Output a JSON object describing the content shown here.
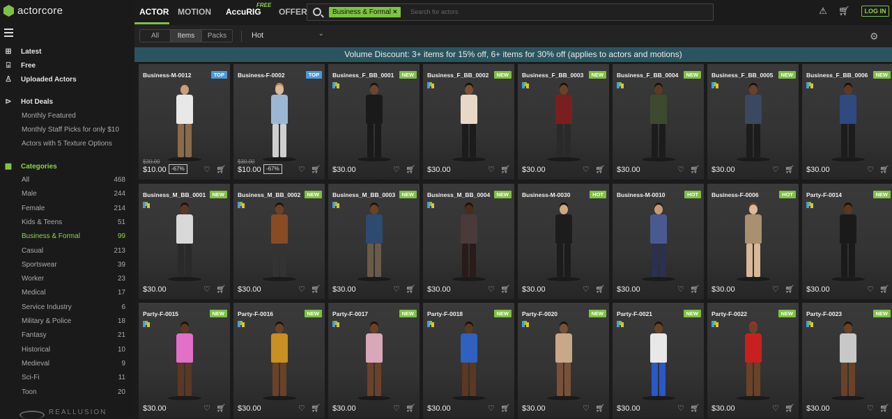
{
  "brand": {
    "logo_text": "actorcore",
    "footer_text": "REALLUSION"
  },
  "sidebar": {
    "main": [
      {
        "label": "Latest",
        "icon": "new-icon"
      },
      {
        "label": "Free",
        "icon": "gift-icon"
      },
      {
        "label": "Uploaded Actors",
        "icon": "user-upload-icon"
      }
    ],
    "hot_deals": {
      "label": "Hot Deals",
      "icon": "tag-icon",
      "items": [
        "Monthly Featured",
        "Monthly Staff Picks for only $10",
        "Actors with 5 Texture Options"
      ]
    },
    "categories": {
      "label": "Categories",
      "icon": "grid-icon",
      "items": [
        {
          "label": "All",
          "count": "468"
        },
        {
          "label": "Male",
          "count": "244"
        },
        {
          "label": "Female",
          "count": "214"
        },
        {
          "label": "Kids & Teens",
          "count": "51"
        },
        {
          "label": "Business & Formal",
          "count": "99",
          "active": true
        },
        {
          "label": "Casual",
          "count": "213"
        },
        {
          "label": "Sportswear",
          "count": "39"
        },
        {
          "label": "Worker",
          "count": "23"
        },
        {
          "label": "Medical",
          "count": "17"
        },
        {
          "label": "Service Industry",
          "count": "6"
        },
        {
          "label": "Military & Police",
          "count": "18"
        },
        {
          "label": "Fantasy",
          "count": "21"
        },
        {
          "label": "Historical",
          "count": "10"
        },
        {
          "label": "Medieval",
          "count": "9"
        },
        {
          "label": "Sci-Fi",
          "count": "11"
        },
        {
          "label": "Toon",
          "count": "20"
        }
      ]
    }
  },
  "topnav": {
    "tabs": [
      "ACTOR",
      "MOTION",
      "AccuRIG",
      "OFFER"
    ],
    "accurig_badge": "FREE",
    "search_chip": "Business & Formal",
    "search_chip_close": "×",
    "search_placeholder": "Search for actors",
    "login": "LOG IN"
  },
  "filter": {
    "segments": [
      "All",
      "Items",
      "Packs"
    ],
    "active_segment": "Items",
    "sort": "Hot"
  },
  "banner": "Volume Discount: 3+ items for 15% off, 6+ items for 30% off (applies to actors and motions)",
  "cards": [
    {
      "name": "Business-M-0012",
      "badge": "TOP",
      "price": "$10.00",
      "old_price": "$30.00",
      "discount": "-67%",
      "icon": false,
      "skin": "#c9a07c",
      "top": "#e8e8e8",
      "legs": "#8a6a48",
      "hair": "#4a3526"
    },
    {
      "name": "Business-F-0002",
      "badge": "TOP",
      "price": "$10.00",
      "old_price": "$30.00",
      "discount": "-67%",
      "icon": false,
      "skin": "#e0b898",
      "top": "#9cb7d4",
      "legs": "#cfcfcf",
      "hair": "#b08858"
    },
    {
      "name": "Business_F_BB_0001",
      "badge": "NEW",
      "price": "$30.00",
      "icon": true,
      "skin": "#6b4630",
      "top": "#1a1a1a",
      "legs": "#1a1a1a",
      "hair": "#1a1208"
    },
    {
      "name": "Business_F_BB_0002",
      "badge": "NEW",
      "price": "$30.00",
      "icon": true,
      "skin": "#7a5038",
      "top": "#e8d8c8",
      "legs": "#1c1c1c",
      "hair": "#1a1208"
    },
    {
      "name": "Business_F_BB_0003",
      "badge": "NEW",
      "price": "$30.00",
      "icon": true,
      "skin": "#6a4228",
      "top": "#7a1f1f",
      "legs": "#2a2a2a",
      "hair": "#1a1208"
    },
    {
      "name": "Business_F_BB_0004",
      "badge": "NEW",
      "price": "$30.00",
      "icon": true,
      "skin": "#5e3a24",
      "top": "#3e4a30",
      "legs": "#1c1c1c",
      "hair": "#1a1208"
    },
    {
      "name": "Business_F_BB_0005",
      "badge": "NEW",
      "price": "$30.00",
      "icon": true,
      "skin": "#6a4228",
      "top": "#3a4860",
      "legs": "#1c1c1c",
      "hair": "#1a1208"
    },
    {
      "name": "Business_F_BB_0006",
      "badge": "NEW",
      "price": "$30.00",
      "icon": true,
      "skin": "#5e3a24",
      "top": "#2e4a80",
      "legs": "#1c1c1c",
      "hair": "#1a1208"
    },
    {
      "name": "Business_M_BB_0001",
      "badge": "NEW",
      "price": "$30.00",
      "icon": true,
      "skin": "#5a3822",
      "top": "#d8d8d8",
      "legs": "#2a2a2a",
      "hair": "#1a1208"
    },
    {
      "name": "Business_M_BB_0002",
      "badge": "NEW",
      "price": "$30.00",
      "icon": true,
      "skin": "#6a4228",
      "top": "#8a4a22",
      "legs": "#333333",
      "hair": "#1a1208"
    },
    {
      "name": "Business_M_BB_0003",
      "badge": "NEW",
      "price": "$30.00",
      "icon": true,
      "skin": "#6a4228",
      "top": "#2e4a70",
      "legs": "#6a5a48",
      "hair": "#1a1208"
    },
    {
      "name": "Business_M_BB_0004",
      "badge": "NEW",
      "price": "$30.00",
      "icon": true,
      "skin": "#4a2c1a",
      "top": "#4a3a3a",
      "legs": "#2a1a1a",
      "hair": "#1a1208"
    },
    {
      "name": "Business-M-0030",
      "badge": "HOT",
      "price": "$30.00",
      "icon": false,
      "skin": "#d0a880",
      "top": "#1c1c1c",
      "legs": "#1c1c1c",
      "hair": "#1a1208"
    },
    {
      "name": "Business-M-0010",
      "badge": "HOT",
      "price": "$30.00",
      "icon": false,
      "skin": "#c89a74",
      "top": "#4a5a90",
      "legs": "#2a3050",
      "hair": "#2a1a10"
    },
    {
      "name": "Business-F-0006",
      "badge": "HOT",
      "price": "$30.00",
      "icon": false,
      "skin": "#e0b898",
      "top": "#a89070",
      "legs": "#d8b898",
      "hair": "#6a4020"
    },
    {
      "name": "Party-F-0014",
      "badge": "NEW",
      "price": "$30.00",
      "icon": true,
      "skin": "#5a3822",
      "top": "#1a1a1a",
      "legs": "#1a1a1a",
      "hair": "#1a1208"
    },
    {
      "name": "Party-F-0015",
      "badge": "NEW",
      "price": "$30.00",
      "icon": true,
      "skin": "#5a3822",
      "top": "#e070c8",
      "legs": "#5a3822",
      "hair": "#1a1208"
    },
    {
      "name": "Party-F-0016",
      "badge": "NEW",
      "price": "$30.00",
      "icon": true,
      "skin": "#6a4228",
      "top": "#c89020",
      "legs": "#6a4228",
      "hair": "#1a1208"
    },
    {
      "name": "Party-F-0017",
      "badge": "NEW",
      "price": "$30.00",
      "icon": true,
      "skin": "#6a4228",
      "top": "#d8a8b8",
      "legs": "#6a4228",
      "hair": "#1a1208"
    },
    {
      "name": "Party-F-0018",
      "badge": "NEW",
      "price": "$30.00",
      "icon": true,
      "skin": "#5a3822",
      "top": "#3060c0",
      "legs": "#5a3822",
      "hair": "#1a1208"
    },
    {
      "name": "Party-F-0020",
      "badge": "NEW",
      "price": "$30.00",
      "icon": true,
      "skin": "#7a5038",
      "top": "#c8a888",
      "legs": "#7a5038",
      "hair": "#1a1208"
    },
    {
      "name": "Party-F-0021",
      "badge": "NEW",
      "price": "$30.00",
      "icon": true,
      "skin": "#6a4228",
      "top": "#e8e8e8",
      "legs": "#2a58c8",
      "hair": "#1a1208"
    },
    {
      "name": "Party-F-0022",
      "badge": "NEW",
      "price": "$30.00",
      "icon": true,
      "skin": "#6a4228",
      "top": "#c82020",
      "legs": "#6a4228",
      "hair": "#c82020"
    },
    {
      "name": "Party-F-0023",
      "badge": "NEW",
      "price": "$30.00",
      "icon": true,
      "skin": "#6a4228",
      "top": "#c8c8c8",
      "legs": "#6a4228",
      "hair": "#1a1208"
    }
  ],
  "colors": {
    "accent": "#7ec242",
    "banner": "#2a5560",
    "top_badge": "#4a9ad8"
  }
}
